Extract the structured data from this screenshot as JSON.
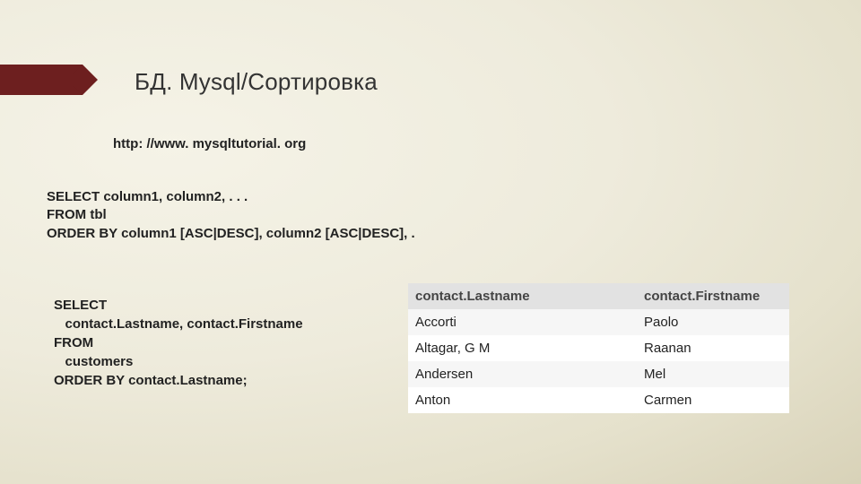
{
  "title": "БД. Mysql/Сортировка",
  "url": "http: //www. mysqltutorial. org",
  "syntax": {
    "line1": "SELECT column1, column2, . . .",
    "line2": "FROM tbl",
    "line3": "ORDER BY column1 [ASC|DESC], column2 [ASC|DESC], ."
  },
  "example": {
    "line1": "SELECT",
    "line2": "   contact.Lastname, contact.Firstname",
    "line3": "FROM",
    "line4": "   customers",
    "line5": "ORDER BY contact.Lastname;"
  },
  "table": {
    "headers": [
      "contact.Lastname",
      "contact.Firstname"
    ],
    "rows": [
      [
        "Accorti",
        "Paolo"
      ],
      [
        "Altagar, G M",
        "Raanan"
      ],
      [
        "Andersen",
        "Mel"
      ],
      [
        "Anton",
        "Carmen"
      ]
    ]
  }
}
